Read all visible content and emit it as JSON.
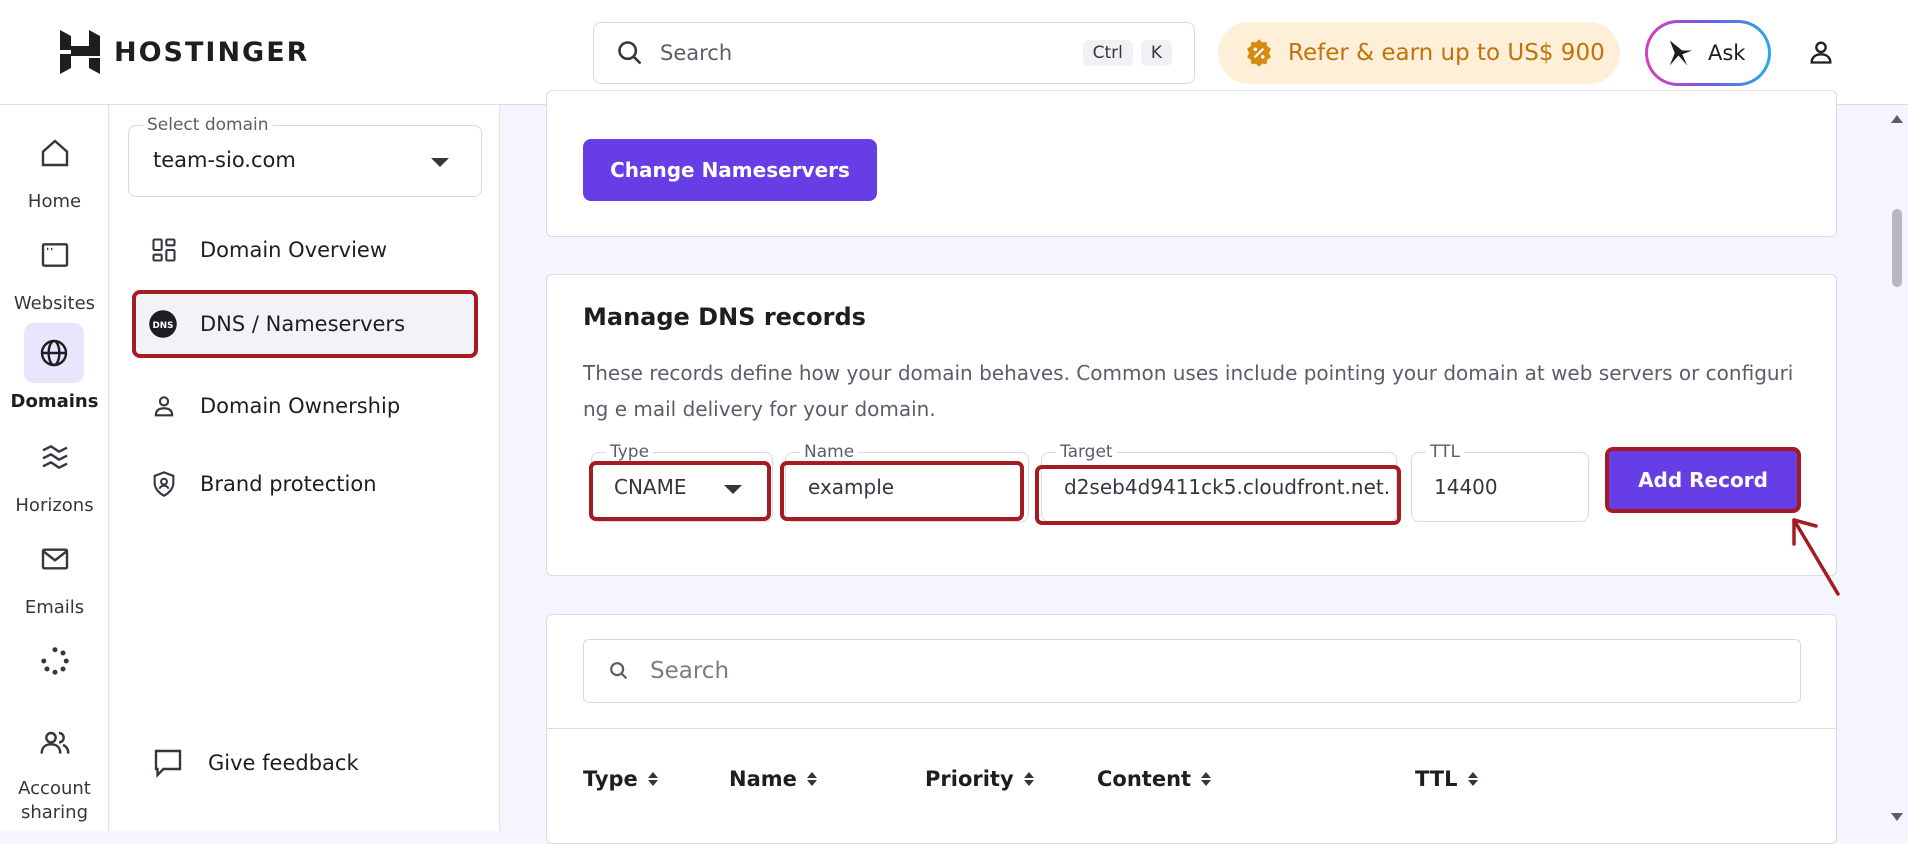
{
  "topbar": {
    "brand": "HOSTINGER",
    "search_placeholder": "Search",
    "shortcut_ctrl": "Ctrl",
    "shortcut_k": "K",
    "refer_label": "Refer & earn up to US$ 900",
    "ask_label": "Ask"
  },
  "rail": {
    "items": [
      {
        "label": "Home",
        "icon": "home-icon"
      },
      {
        "label": "Websites",
        "icon": "browser-icon"
      },
      {
        "label": "Domains",
        "icon": "globe-icon"
      },
      {
        "label": "Horizons",
        "icon": "horizons-icon"
      },
      {
        "label": "Emails",
        "icon": "mail-icon"
      },
      {
        "label": "",
        "icon": "spinner-icon"
      },
      {
        "label": "Account sharing",
        "icon": "users-icon"
      }
    ]
  },
  "sidenav": {
    "domain_legend": "Select domain",
    "domain_value": "team-sio.com",
    "items": [
      {
        "label": "Domain Overview"
      },
      {
        "label": "DNS / Nameservers"
      },
      {
        "label": "Domain Ownership"
      },
      {
        "label": "Brand protection"
      }
    ],
    "feedback": "Give feedback"
  },
  "nameservers": {
    "change_button": "Change Nameservers"
  },
  "dns": {
    "title": "Manage DNS records",
    "description": "These records define how your domain behaves. Common uses include pointing your domain at web servers or configuring e mail delivery for your domain.",
    "type_legend": "Type",
    "type_value": "CNAME",
    "name_legend": "Name",
    "name_value": "example",
    "target_legend": "Target",
    "target_value": "d2seb4d9411ck5.cloudfront.net.",
    "ttl_legend": "TTL",
    "ttl_value": "14400",
    "add_button": "Add Record"
  },
  "records_table": {
    "search_placeholder": "Search",
    "columns": [
      "Type",
      "Name",
      "Priority",
      "Content",
      "TTL"
    ]
  },
  "colors": {
    "primary": "#673de6",
    "highlight": "#a41b22",
    "refer_bg": "#feefd9",
    "refer_text": "#c17208"
  }
}
